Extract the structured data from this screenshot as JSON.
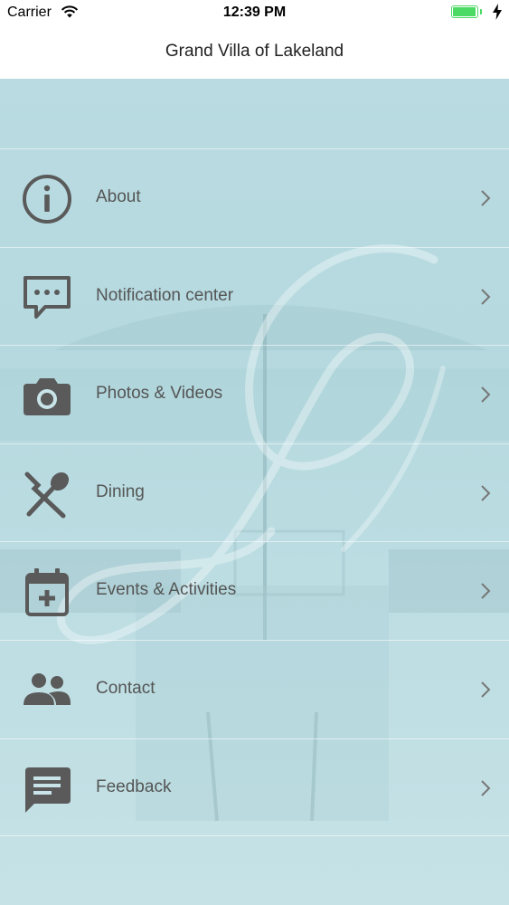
{
  "status_bar": {
    "carrier": "Carrier",
    "time": "12:39 PM",
    "battery_level": 1.0,
    "battery_color": "#4cd964"
  },
  "nav": {
    "title": "Grand Villa of Lakeland"
  },
  "menu": {
    "items": [
      {
        "label": "About",
        "icon": "info-icon"
      },
      {
        "label": "Notification center",
        "icon": "chat-bubble-icon"
      },
      {
        "label": "Photos & Videos",
        "icon": "camera-icon"
      },
      {
        "label": "Dining",
        "icon": "fork-spoon-icon"
      },
      {
        "label": "Events & Activities",
        "icon": "calendar-add-icon"
      },
      {
        "label": "Contact",
        "icon": "people-icon"
      },
      {
        "label": "Feedback",
        "icon": "feedback-icon"
      }
    ]
  },
  "colors": {
    "icon": "#5a5a5a",
    "label": "#555555",
    "background_tint": "#b9dbe1"
  }
}
